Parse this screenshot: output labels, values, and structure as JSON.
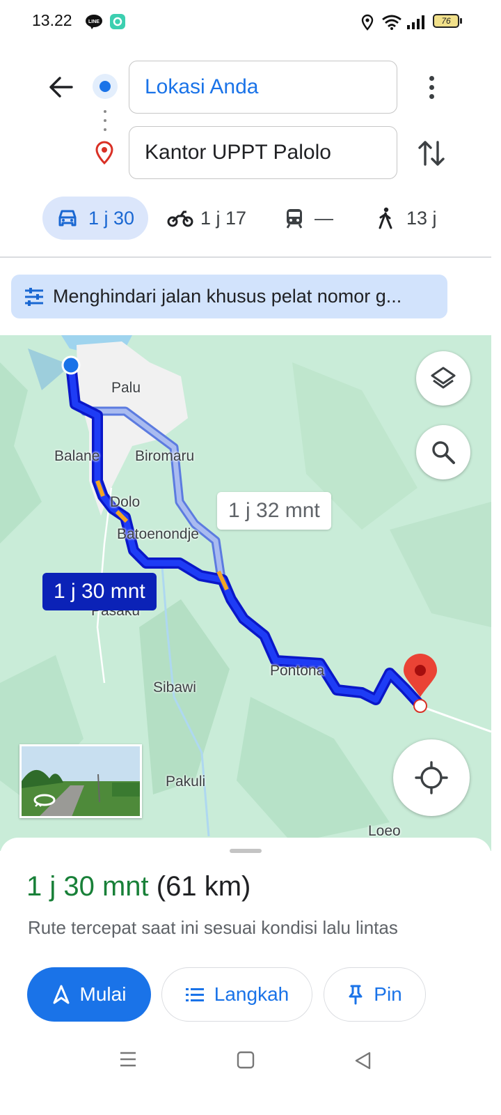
{
  "status_bar": {
    "time": "13.22",
    "battery_level": "76",
    "icons": [
      "line-app-icon",
      "notification-app-icon",
      "location-icon",
      "wifi-icon",
      "signal-icon",
      "battery-icon"
    ]
  },
  "directions": {
    "origin": "Lokasi Anda",
    "destination": "Kantor UPPT Palolo"
  },
  "modes": [
    {
      "icon": "car-icon",
      "label": "1 j 30",
      "selected": true
    },
    {
      "icon": "motorcycle-icon",
      "label": "1 j 17",
      "selected": false
    },
    {
      "icon": "transit-icon",
      "label": "—",
      "selected": false
    },
    {
      "icon": "walk-icon",
      "label": "13 j",
      "selected": false
    }
  ],
  "filter_chip": "Menghindari jalan khusus pelat nomor g...",
  "map": {
    "places": [
      "Palu",
      "Balane",
      "Biromaru",
      "Dolo",
      "Batoenondje",
      "Pasaku",
      "Pontona",
      "Sibawi",
      "Pakuli",
      "Loeo"
    ],
    "alt_route_eta": "1 j 32 mnt",
    "main_route_eta": "1 j 30 mnt",
    "colors": {
      "route": "#1212f0",
      "alt_route": "#8ea6ea",
      "traffic": "#f4a623",
      "destination_pin": "#e53935",
      "water": "#9fd4ee",
      "urban": "#f1f1f1"
    }
  },
  "sheet": {
    "duration": "1 j 30 mnt",
    "distance": "(61 km)",
    "subtitle": "Rute tercepat saat ini sesuai kondisi lalu lintas",
    "start_label": "Mulai",
    "steps_label": "Langkah",
    "pin_label": "Pin"
  }
}
